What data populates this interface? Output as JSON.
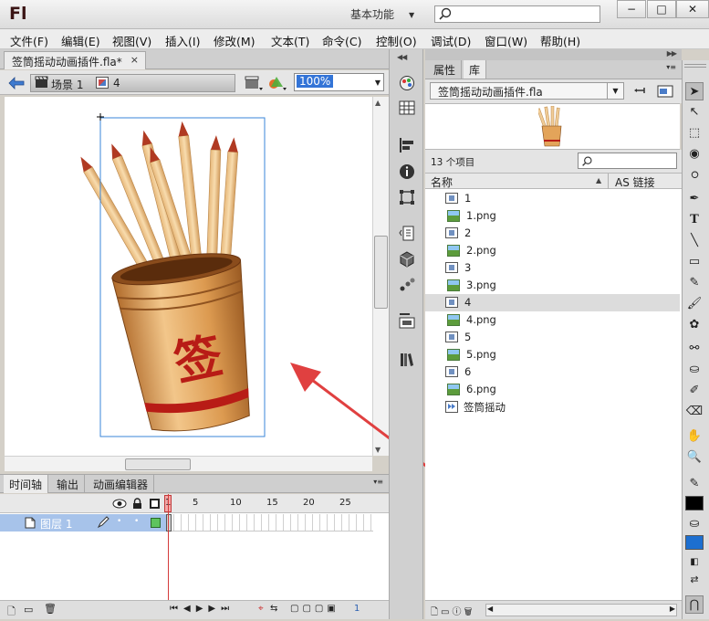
{
  "app": {
    "logo": "Fl",
    "workspace": "基本功能",
    "search_placeholder": ""
  },
  "window": {
    "minimize": "−",
    "maximize": "□",
    "close": "✕"
  },
  "menu": [
    "文件(F)",
    "编辑(E)",
    "视图(V)",
    "插入(I)",
    "修改(M)",
    "文本(T)",
    "命令(C)",
    "控制(O)",
    "调试(D)",
    "窗口(W)",
    "帮助(H)"
  ],
  "document": {
    "tab_title": "签筒摇动动画插件.fla*",
    "close": "×"
  },
  "scene": {
    "scene_label": "场景 1",
    "symbol_label": "4",
    "zoom": "100%"
  },
  "stage": {
    "character": "签",
    "colors": {
      "cup": "#e3a45a",
      "stripe": "#b81c16",
      "arrow": "#e04040",
      "selection": "#3a86d8"
    }
  },
  "timeline": {
    "tabs": [
      "时间轴",
      "输出",
      "动画编辑器"
    ],
    "frame_numbers": [
      "1",
      "5",
      "10",
      "15",
      "20",
      "25"
    ],
    "layer_name": "图层 1",
    "current_frame": "1",
    "header_icons": [
      "eye-icon",
      "lock-icon",
      "outline-icon"
    ]
  },
  "right_panel": {
    "tabs": [
      "属性",
      "库"
    ],
    "library_file": "签筒摇动动画插件.fla",
    "item_count": "13 个项目",
    "columns": [
      "名称",
      "AS 链接"
    ],
    "items": [
      {
        "name": "1",
        "type": "symbol"
      },
      {
        "name": "1.png",
        "type": "bitmap"
      },
      {
        "name": "2",
        "type": "symbol"
      },
      {
        "name": "2.png",
        "type": "bitmap"
      },
      {
        "name": "3",
        "type": "symbol"
      },
      {
        "name": "3.png",
        "type": "bitmap"
      },
      {
        "name": "4",
        "type": "symbol",
        "selected": true
      },
      {
        "name": "4.png",
        "type": "bitmap"
      },
      {
        "name": "5",
        "type": "symbol"
      },
      {
        "name": "5.png",
        "type": "bitmap"
      },
      {
        "name": "6",
        "type": "symbol"
      },
      {
        "name": "6.png",
        "type": "bitmap"
      },
      {
        "name": "签筒摇动",
        "type": "movieclip"
      }
    ]
  }
}
